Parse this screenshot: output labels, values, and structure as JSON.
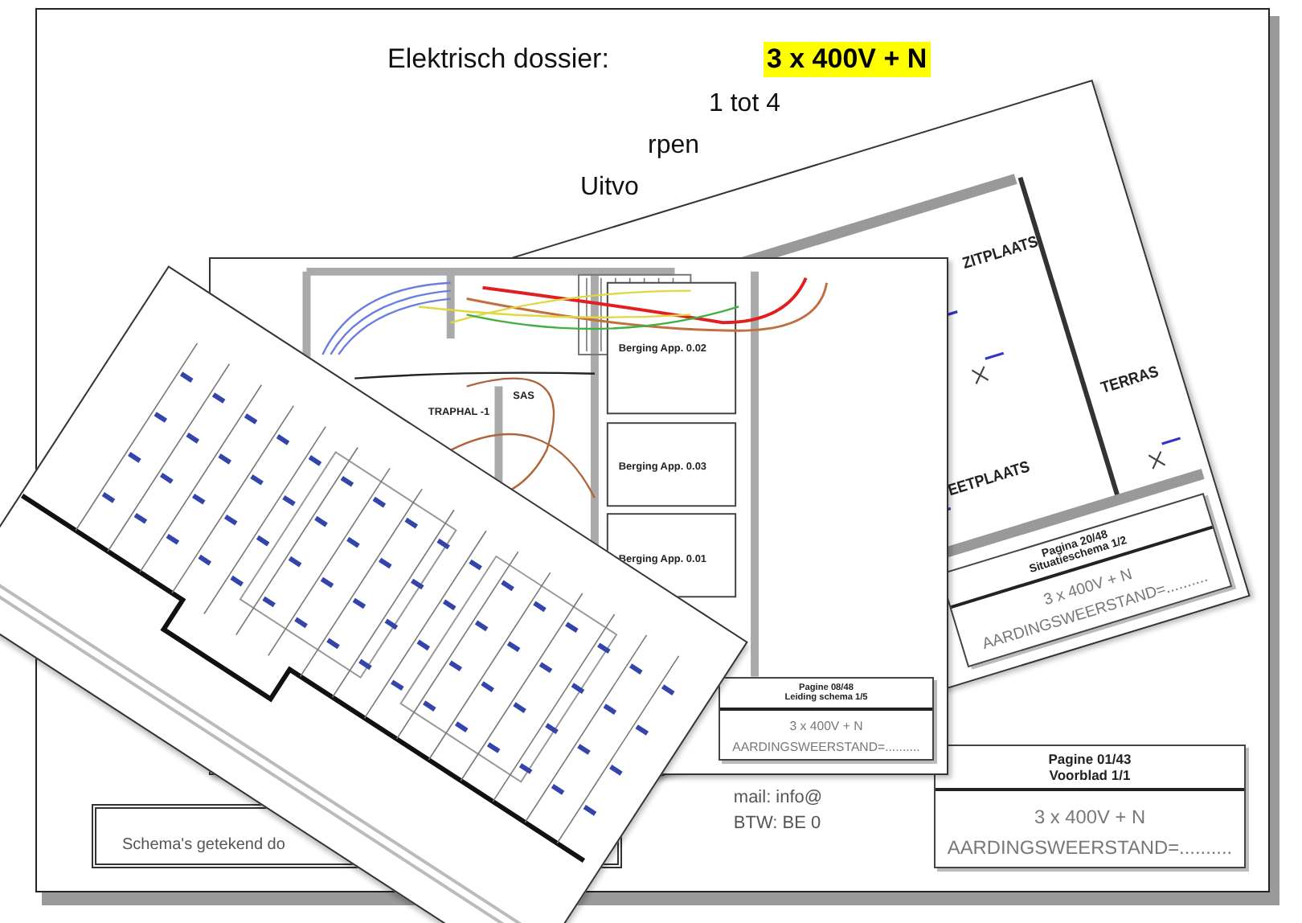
{
  "cover": {
    "title": "Elektrisch dossier:",
    "highlight": "3 x 400V + N",
    "lines": [
      "1 tot 4",
      "rpen",
      "Uitvo"
    ],
    "note": "Schema's getekend do",
    "address": [
      "mail: info@",
      "BTW: BE 0"
    ],
    "title_block": {
      "page": "Pagine 01/43",
      "sheet": "Voorblad 1/1",
      "supply": "3 x 400V + N",
      "earthing": "AARDINGSWEERSTAND=.........."
    }
  },
  "situation_sheet": {
    "rooms": [
      "ZITPLAATS",
      "TERRAS",
      "EETPLAATS"
    ],
    "title_block": {
      "page": "Pagina 20/48",
      "sheet": "Situatieschema 1/2",
      "supply": "3 x 400V + N",
      "earthing": "AARDINGSWEERSTAND=.........."
    }
  },
  "wiring_sheet": {
    "rooms": [
      "TRAPHAL -1",
      "SAS",
      "Berging App. 0.02",
      "Berging App. 0.03",
      "Berging App. 0.01"
    ],
    "title_block": {
      "page": "Pagine 08/48",
      "sheet": "Leiding schema 1/5",
      "supply": "3 x 400V + N",
      "earthing": "AARDINGSWEERSTAND=.........."
    }
  }
}
